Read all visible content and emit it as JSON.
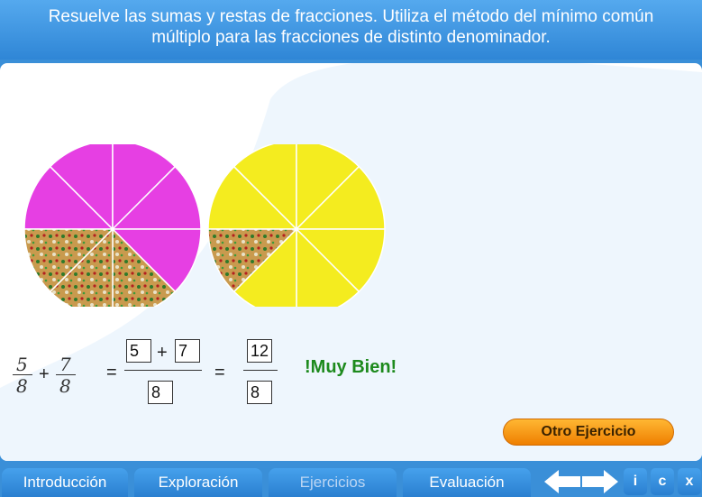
{
  "header": {
    "line1": "Resuelve las sumas y restas de fracciones. Utiliza el método del mínimo común",
    "line2": "múltiplo para las fracciones de distinto denominador."
  },
  "exercise": {
    "frac1": {
      "num": "5",
      "den": "8"
    },
    "plus": "+",
    "frac2": {
      "num": "7",
      "den": "8"
    },
    "equals": "=",
    "box_num1": "5",
    "box_plus": "+",
    "box_num2": "7",
    "box_den": "8",
    "result_num": "12",
    "result_den": "8"
  },
  "feedback": "!Muy Bien!",
  "buttons": {
    "otro": "Otro Ejercicio"
  },
  "nav": {
    "tabs": [
      "Introducción",
      "Exploración",
      "Ejercicios",
      "Evaluación"
    ],
    "active": "Ejercicios",
    "info": "i",
    "credits": "c",
    "close": "x"
  },
  "colors": {
    "pink": "#e63fe3",
    "yellow": "#f4ec1f",
    "green_text": "#1d8a1d",
    "header_blue": "#3a8fd8"
  },
  "pizzas": {
    "per_pizza_slices": 8,
    "pink_shaded": 5,
    "yellow_shaded": 7
  }
}
